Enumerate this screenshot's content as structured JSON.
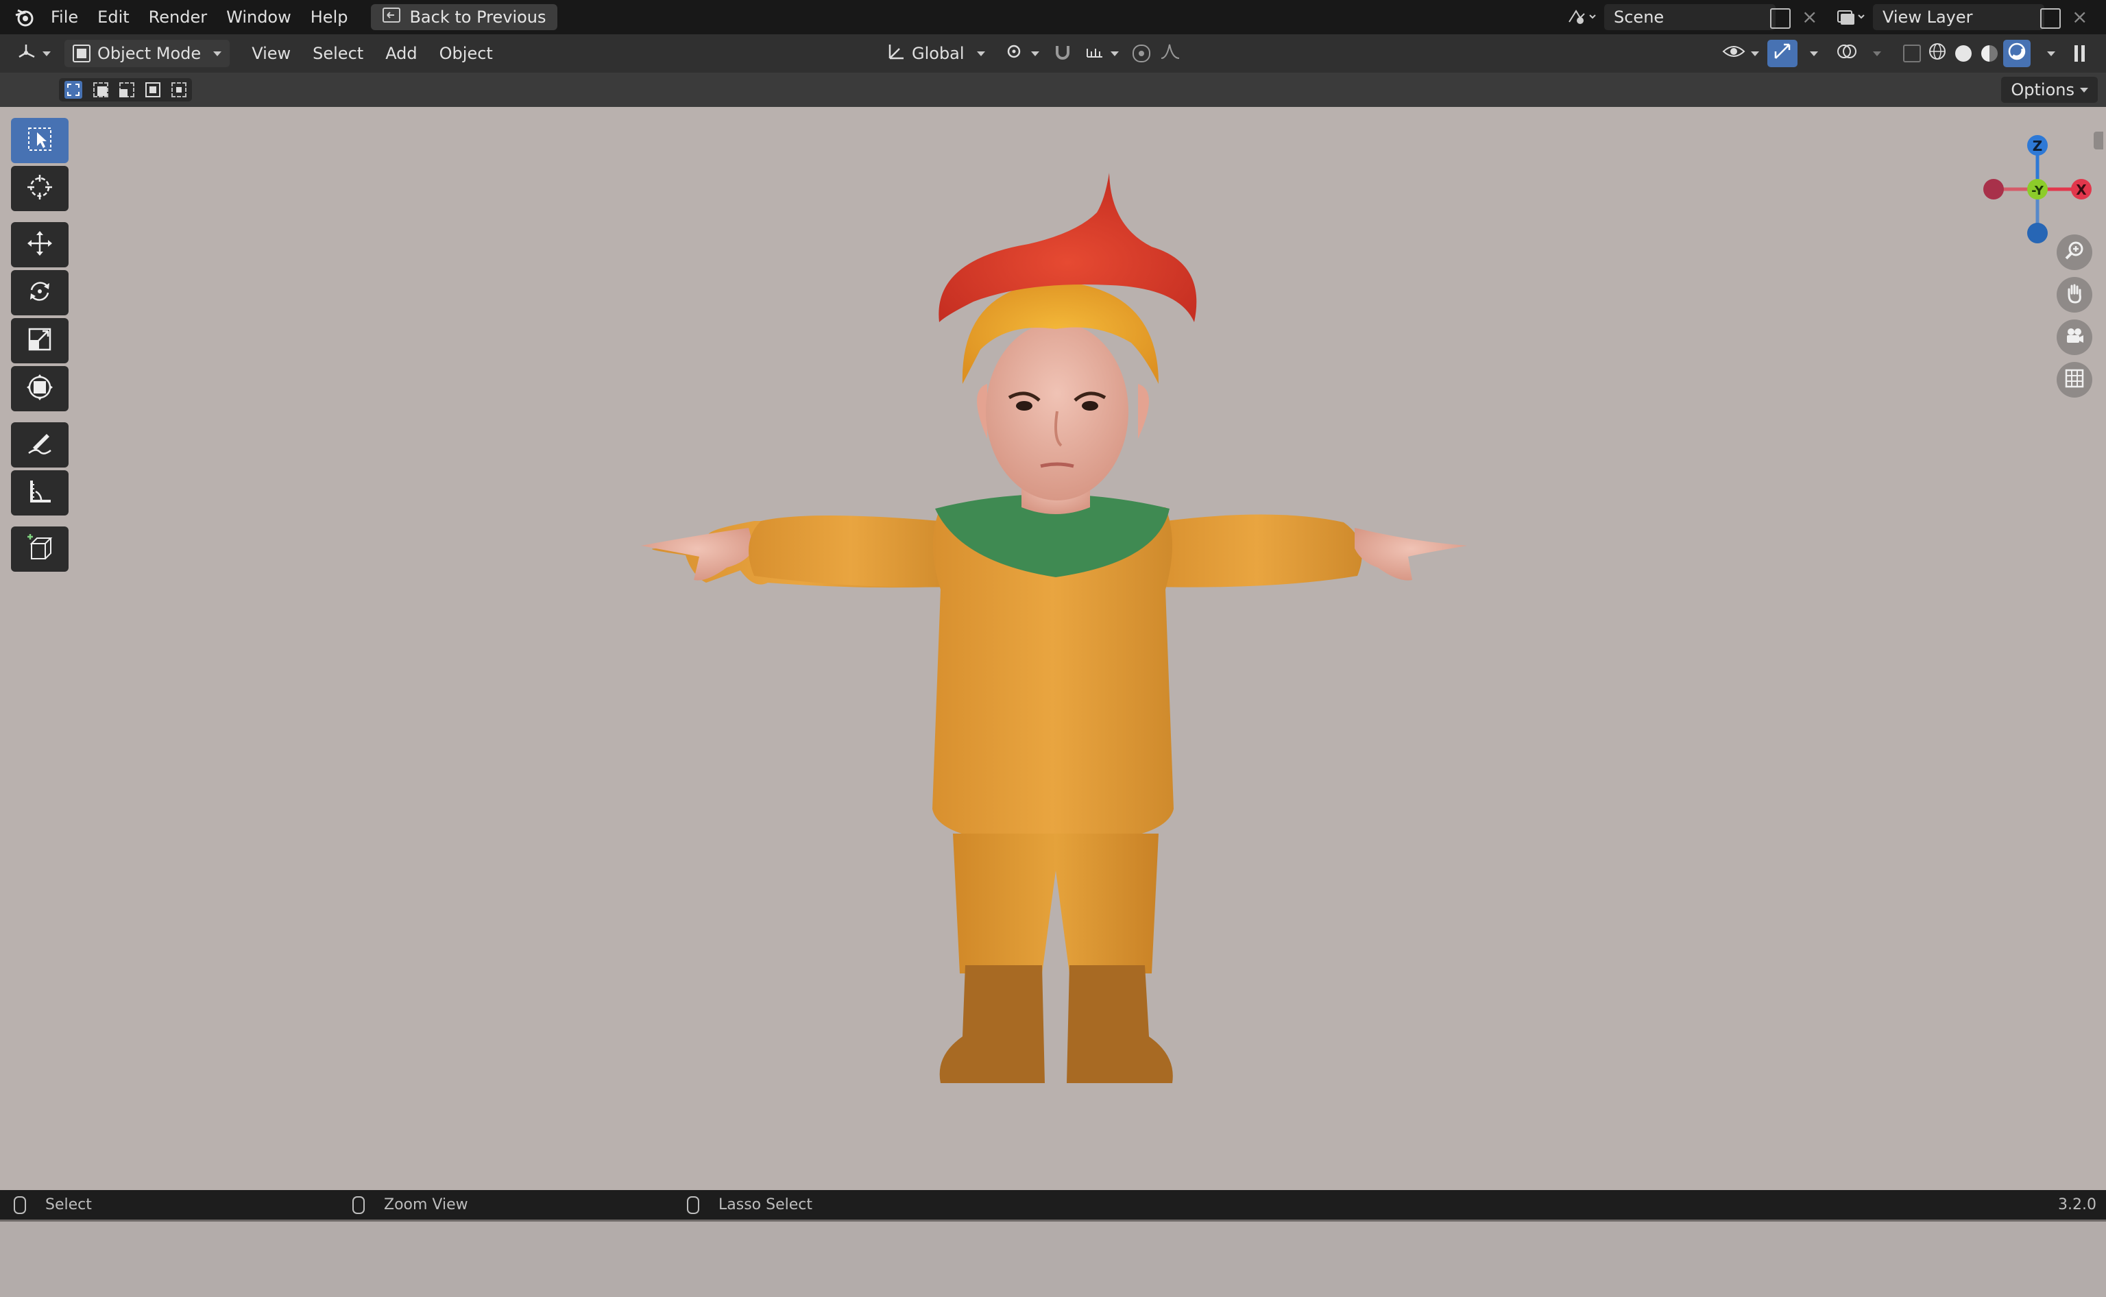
{
  "topbar": {
    "menus": [
      "File",
      "Edit",
      "Render",
      "Window",
      "Help"
    ],
    "back_label": "Back to Previous",
    "scene_label": "Scene",
    "view_layer_label": "View Layer"
  },
  "header": {
    "mode": "Object Mode",
    "menus": [
      "View",
      "Select",
      "Add",
      "Object"
    ],
    "transform_orientation": "Global"
  },
  "toolrow": {
    "options_label": "Options"
  },
  "gizmo": {
    "x": "X",
    "y": "-Y",
    "z": "Z",
    "colors": {
      "x": "#e2374c",
      "y": "#8ccc2a",
      "z": "#2e79d6"
    }
  },
  "tools": [
    {
      "icon": "select-box-icon",
      "active": true
    },
    {
      "icon": "cursor-icon",
      "active": false
    },
    {
      "icon": "move-icon",
      "active": false
    },
    {
      "icon": "rotate-icon",
      "active": false
    },
    {
      "icon": "scale-icon",
      "active": false
    },
    {
      "icon": "transform-icon",
      "active": false
    },
    {
      "icon": "annotate-icon",
      "active": false
    },
    {
      "icon": "measure-icon",
      "active": false
    },
    {
      "icon": "add-cube-icon",
      "active": false
    }
  ],
  "statusbar": {
    "select": "Select",
    "zoom": "Zoom View",
    "lasso": "Lasso Select",
    "version": "3.2.0"
  }
}
